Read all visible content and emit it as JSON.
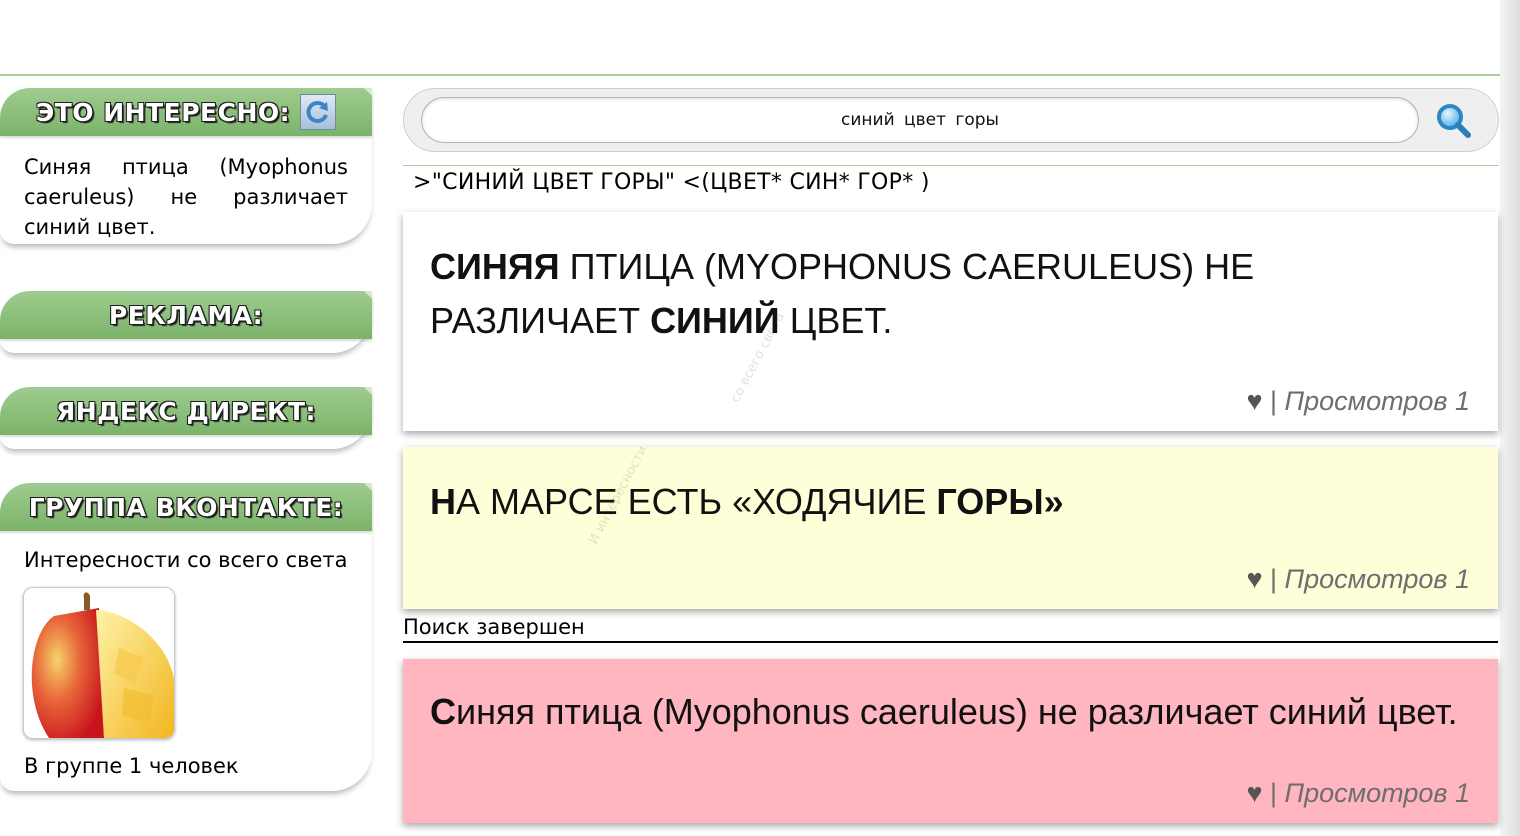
{
  "sidebar": {
    "interesting": {
      "title": "ЭТО ИНТЕРЕСНО:",
      "text": "Синяя птица (Myophonus caeruleus) не различает синий цвет."
    },
    "ads": {
      "title": "РЕКЛАМА:"
    },
    "direct": {
      "title": "ЯНДЕКС ДИРЕКТ:"
    },
    "vk": {
      "title": "ГРУППА ВКОНТАКТЕ:",
      "group_name": "Интересности со всего света",
      "members": "В группе 1 человек"
    }
  },
  "search": {
    "value": "синий цвет горы",
    "query_expansion": ">\"СИНИЙ ЦВЕТ ГОРЫ\" <(ЦВЕТ* СИН* ГОР* )"
  },
  "results": [
    {
      "parts": [
        {
          "text": "Синяя",
          "bold": true
        },
        {
          "text": " птица (Myophonus caeruleus) не различает ",
          "bold": false
        },
        {
          "text": "синий",
          "bold": true
        },
        {
          "text": " цвет.",
          "bold": false
        }
      ],
      "heart": "♥",
      "separator": " | ",
      "views": "Просмотров 1",
      "bg": "#ffffff"
    },
    {
      "parts": [
        {
          "text": "Н",
          "bold": true
        },
        {
          "text": "а Марсе есть «ходячие ",
          "bold": false
        },
        {
          "text": "горы»",
          "bold": true
        }
      ],
      "heart": "♥",
      "separator": " | ",
      "views": "Просмотров 1",
      "bg": "#fefed9"
    }
  ],
  "status": "Поиск завершен",
  "featured": {
    "parts": [
      {
        "text": "С",
        "bold": true
      },
      {
        "text": "иняя птица (Myophonus caeruleus) не различает синий цвет.",
        "bold": false
      }
    ],
    "heart": "♥",
    "separator": " | ",
    "views": "Просмотров 1",
    "bg": "#ffb6c1"
  },
  "watermarks": [
    "со всего света",
    "И интересности"
  ],
  "colors": {
    "header_green": "#8fc27e",
    "divider_green": "#a9cf9b",
    "featured_pink": "#ffb6c1",
    "result_yellow": "#fefed9"
  }
}
